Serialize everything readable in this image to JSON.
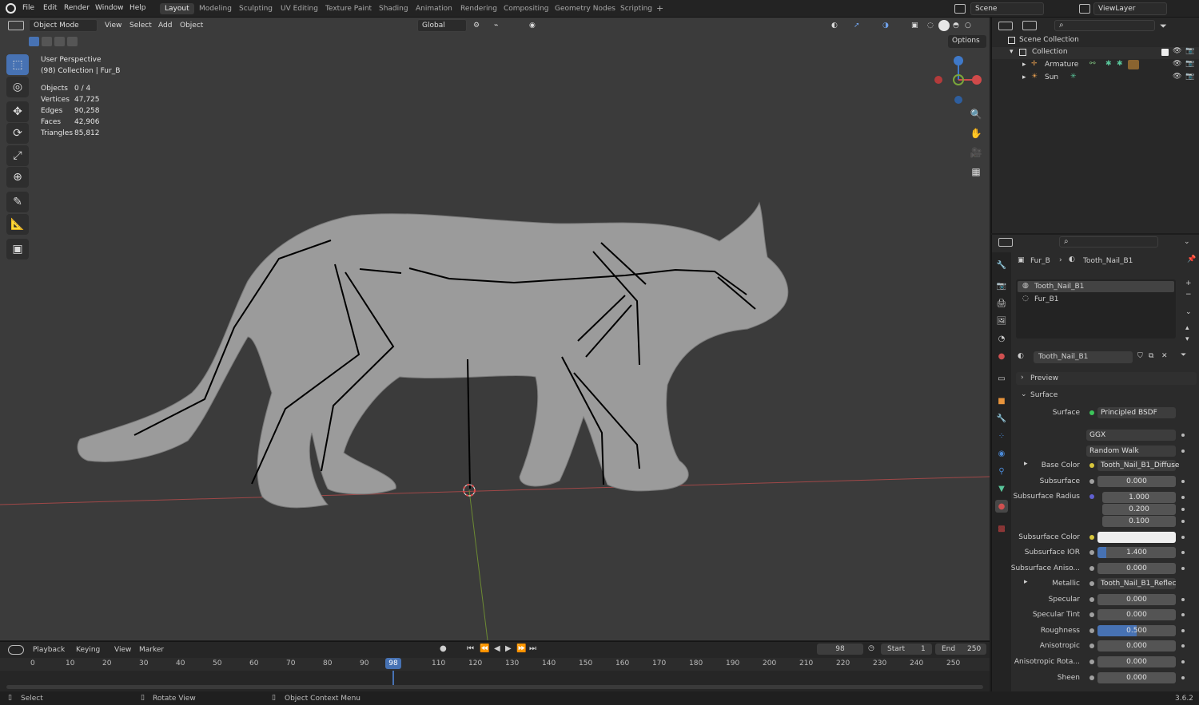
{
  "menu": [
    "File",
    "Edit",
    "Render",
    "Window",
    "Help"
  ],
  "workspaces": [
    "Layout",
    "Modeling",
    "Sculpting",
    "UV Editing",
    "Texture Paint",
    "Shading",
    "Animation",
    "Rendering",
    "Compositing",
    "Geometry Nodes",
    "Scripting"
  ],
  "active_workspace": "Layout",
  "scene": "Scene",
  "view_layer": "ViewLayer",
  "viewport": {
    "mode": "Object Mode",
    "menus": [
      "View",
      "Select",
      "Add",
      "Object"
    ],
    "orientation": "Global",
    "options_label": "Options",
    "view_name": "User Perspective",
    "collection_info": "(98) Collection | Fur_B",
    "stats": [
      {
        "label": "Objects",
        "value": "0 / 4"
      },
      {
        "label": "Vertices",
        "value": "47,725"
      },
      {
        "label": "Edges",
        "value": "90,258"
      },
      {
        "label": "Faces",
        "value": "42,906"
      },
      {
        "label": "Triangles",
        "value": "85,812"
      }
    ]
  },
  "outliner": {
    "root": "Scene Collection",
    "collection": "Collection",
    "items": [
      "Armature",
      "Sun"
    ]
  },
  "properties": {
    "breadcrumb_object": "Fur_B",
    "breadcrumb_material": "Tooth_Nail_B1",
    "slots": [
      "Tooth_Nail_B1",
      "Fur_B1"
    ],
    "material_name": "Tooth_Nail_B1",
    "panel_preview": "Preview",
    "panel_surface": "Surface",
    "surface_label": "Surface",
    "surface_value": "Principled BSDF",
    "distribution": "GGX",
    "subsurface_method": "Random Walk",
    "base_color_label": "Base Color",
    "base_color_value": "Tooth_Nail_B1_Diffuse",
    "subsurface_label": "Subsurface",
    "subsurface_value": "0.000",
    "subsurface_radius_label": "Subsurface Radius",
    "subsurface_radius": [
      "1.000",
      "0.200",
      "0.100"
    ],
    "subsurface_color_label": "Subsurface Color",
    "subsurface_ior_label": "Subsurface IOR",
    "subsurface_ior_value": "1.400",
    "subsurface_aniso_label": "Subsurface Aniso...",
    "subsurface_aniso_value": "0.000",
    "metallic_label": "Metallic",
    "metallic_value": "Tooth_Nail_B1_Reflect...",
    "specular_label": "Specular",
    "specular_value": "0.000",
    "specular_tint_label": "Specular Tint",
    "specular_tint_value": "0.000",
    "roughness_label": "Roughness",
    "roughness_value": "0.500",
    "roughness_fraction": 0.5,
    "anisotropic_label": "Anisotropic",
    "anisotropic_value": "0.000",
    "anisotropic_rot_label": "Anisotropic Rota...",
    "anisotropic_rot_value": "0.000",
    "sheen_label": "Sheen",
    "sheen_value": "0.000"
  },
  "timeline": {
    "menus": [
      "Playback",
      "Keying",
      "View",
      "Marker"
    ],
    "current_frame": "98",
    "start_label": "Start",
    "start": "1",
    "end_label": "End",
    "end": "250",
    "ticks": [
      "0",
      "10",
      "20",
      "30",
      "40",
      "50",
      "60",
      "70",
      "80",
      "90",
      "110",
      "120",
      "130",
      "140",
      "150",
      "160",
      "170",
      "180",
      "190",
      "200",
      "210",
      "220",
      "230",
      "240",
      "250"
    ],
    "cursor_label": "98"
  },
  "statusbar": {
    "select": "Select",
    "rotate": "Rotate View",
    "context": "Object Context Menu",
    "version": "3.6.2"
  },
  "colors": {
    "accent": "#4772b3",
    "active_tool": "#4772b3",
    "x_axis": "#d04a4a",
    "y_axis": "#7aa63a",
    "z_axis": "#3f79c9"
  }
}
